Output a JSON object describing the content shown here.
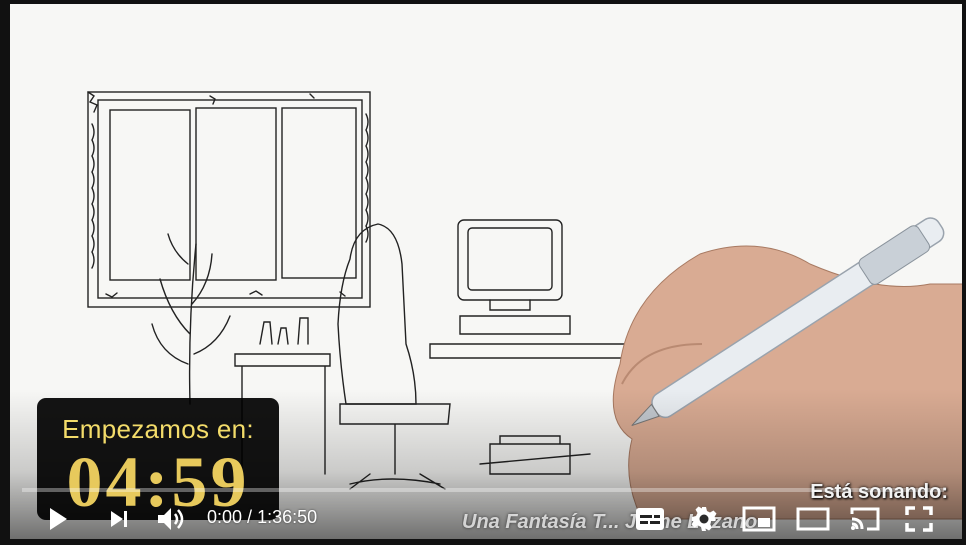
{
  "video": {
    "countdown_label": "Empezamos en:",
    "countdown_time": "04:59",
    "now_playing_label": "Está sonando:",
    "now_playing_title": "Una Fantasía T... Jaime Lozano"
  },
  "player": {
    "current_time": "0:00",
    "separator": " / ",
    "duration": "1:36:50",
    "progress_fraction": 0.0,
    "accent": "#ff0000",
    "icons": [
      "play-icon",
      "next-icon",
      "volume-icon",
      "subtitles-icon",
      "settings-icon",
      "miniplayer-icon",
      "theater-icon",
      "cast-icon",
      "fullscreen-icon"
    ]
  }
}
